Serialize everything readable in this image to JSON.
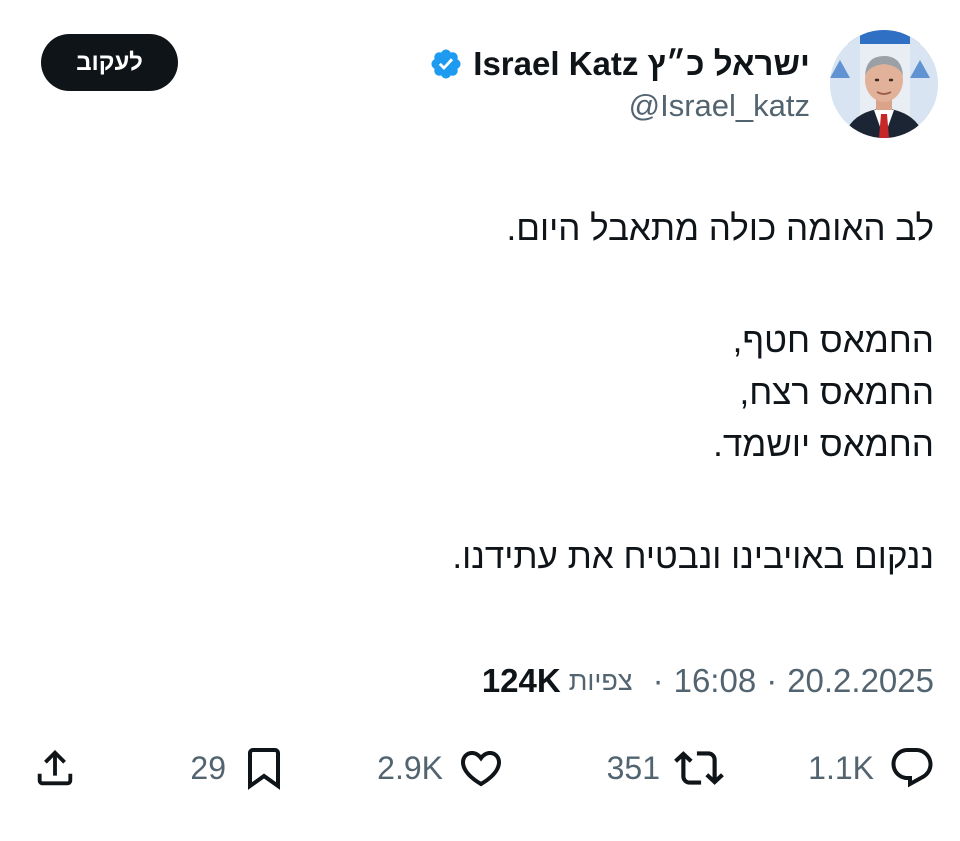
{
  "author": {
    "name": "ישראל כ״ץ Israel Katz",
    "handle": "@Israel_katz",
    "verified": true,
    "verified_color": "#1d9bf0",
    "avatar_icon": "profile-photo"
  },
  "follow_button": {
    "label": "לעקוב"
  },
  "tweet": {
    "lines": [
      "לב האומה כולה מתאבל היום.",
      "החמאס חטף,",
      "החמאס רצח,",
      "החמאס יושמד.",
      "ננקום באויבינו ונבטיח את עתידנו."
    ]
  },
  "meta": {
    "date": "20.2.2025",
    "separator": "·",
    "time": "16:08",
    "views_label": "צפיות",
    "views_count": "124K"
  },
  "actions": {
    "reply": {
      "icon": "reply-icon",
      "count": "1.1K"
    },
    "retweet": {
      "icon": "retweet-icon",
      "count": "351"
    },
    "like": {
      "icon": "heart-icon",
      "count": "2.9K"
    },
    "bookmark": {
      "icon": "bookmark-icon",
      "count": "29"
    },
    "share": {
      "icon": "share-icon"
    }
  },
  "colors": {
    "text_primary": "#0f1419",
    "text_secondary": "#536471",
    "button_bg": "#0f1419",
    "button_text": "#ffffff"
  }
}
